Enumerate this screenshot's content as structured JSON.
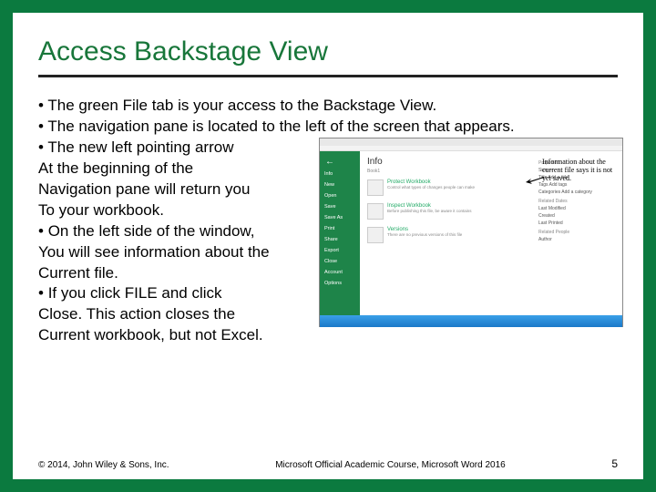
{
  "title": "Access Backstage View",
  "lines": [
    {
      "bullet": true,
      "text": "The green File tab is your access to the Backstage View."
    },
    {
      "bullet": true,
      "text": "The navigation pane is located to the left of the screen that appears."
    },
    {
      "bullet": true,
      "text": "The new left pointing arrow"
    },
    {
      "bullet": false,
      "text": "At the beginning of the"
    },
    {
      "bullet": false,
      "text": "Navigation pane will return you"
    },
    {
      "bullet": false,
      "text": "To your workbook."
    },
    {
      "bullet": true,
      "text": "On the left side of the window,"
    },
    {
      "bullet": false,
      "text": "You will see information about the"
    },
    {
      "bullet": false,
      "text": "Current file."
    },
    {
      "bullet": true,
      "text": "If you click FILE and click"
    },
    {
      "bullet": false,
      "text": "Close. This action closes the"
    },
    {
      "bullet": false,
      "text": "Current workbook, but not Excel."
    }
  ],
  "callout": "Information about the current file says it is not yet saved.",
  "figure": {
    "info_title": "Info",
    "info_sub": "Book1",
    "nav": [
      "Info",
      "New",
      "Open",
      "Save",
      "Save As",
      "Print",
      "Share",
      "Export",
      "Close",
      "Account",
      "Options"
    ],
    "blocks": [
      {
        "t": "Protect Workbook",
        "s": "Control what types of changes people can make"
      },
      {
        "t": "Inspect Workbook",
        "s": "Before publishing this file, be aware it contains"
      },
      {
        "t": "Versions",
        "s": "There are no previous versions of this file"
      }
    ],
    "props_h1": "Properties",
    "props1": [
      "Size  —",
      "Title  Add a title",
      "Tags  Add tags",
      "Categories  Add a category"
    ],
    "props_h2": "Related Dates",
    "props2": [
      "Last Modified",
      "Created",
      "Last Printed"
    ],
    "props_h3": "Related People",
    "props3": [
      "Author"
    ]
  },
  "footer": {
    "left": "© 2014, John Wiley & Sons, Inc.",
    "mid": "Microsoft Official Academic Course, Microsoft Word 2016",
    "page": "5"
  }
}
